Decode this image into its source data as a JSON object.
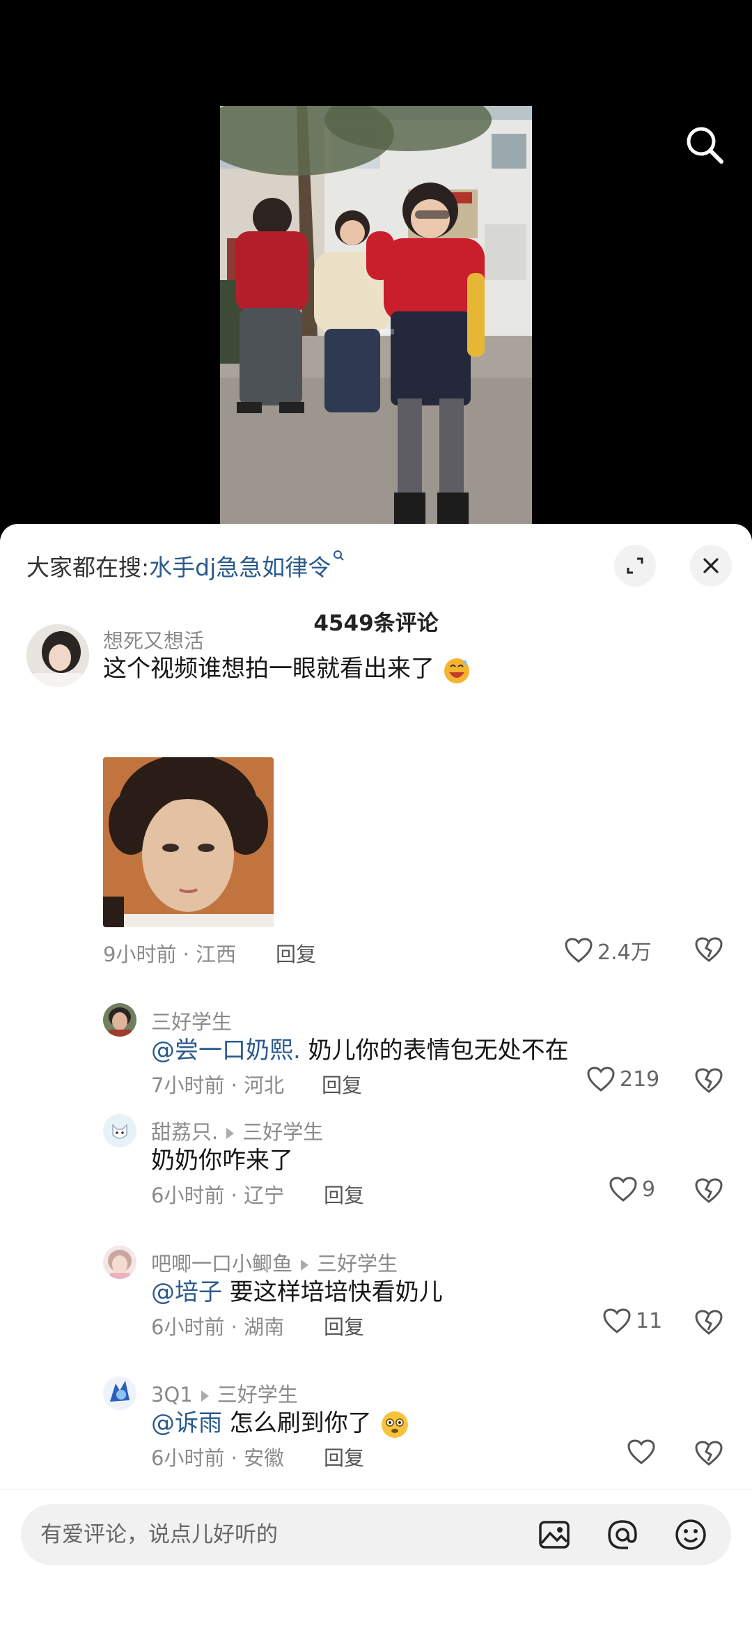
{
  "hot_search": {
    "prefix": "大家都在搜:",
    "term": "水手dj急急如律令"
  },
  "comment_count": "4549条评论",
  "comments": [
    {
      "user": "想死又想活",
      "text": "这个视频谁想拍一眼就看出来了",
      "emoji": "grinning-sweat-emoji",
      "meta": "9小时前 · 江西",
      "reply": "回复",
      "likes": "2.4万"
    },
    {
      "user": "三好学生",
      "mention": "@尝一口奶熙.",
      "text": " 奶儿你的表情包无处不在",
      "meta": "7小时前 · 河北",
      "reply": "回复",
      "likes": "219"
    },
    {
      "user": "甜荔只.",
      "reply_to": "三好学生",
      "text": "奶奶你咋来了",
      "meta": "6小时前 · 辽宁",
      "reply": "回复",
      "likes": "9"
    },
    {
      "user": "吧唧一口小鲫鱼",
      "reply_to": "三好学生",
      "mention": "@培子",
      "text": " 要这样培培快看奶儿",
      "meta": "6小时前 · 湖南",
      "reply": "回复",
      "likes": "11"
    },
    {
      "user": "3Q1",
      "reply_to": "三好学生",
      "mention": "@诉雨",
      "text": " 怎么刷到你了",
      "emoji": "flushed-emoji",
      "meta": "6小时前 · 安徽",
      "reply": "回复",
      "likes": ""
    }
  ],
  "input": {
    "placeholder": "有爱评论，说点儿好听的"
  },
  "icons": {
    "search": "search-icon",
    "expand": "expand-icon",
    "close": "close-icon",
    "image": "image-icon",
    "at": "at-icon",
    "emoji": "smile-icon",
    "like": "heart-icon",
    "dislike": "broken-heart-icon"
  },
  "colors": {
    "mention": "#2a5a8c",
    "sheet": "#ffffff",
    "background": "#000000"
  }
}
